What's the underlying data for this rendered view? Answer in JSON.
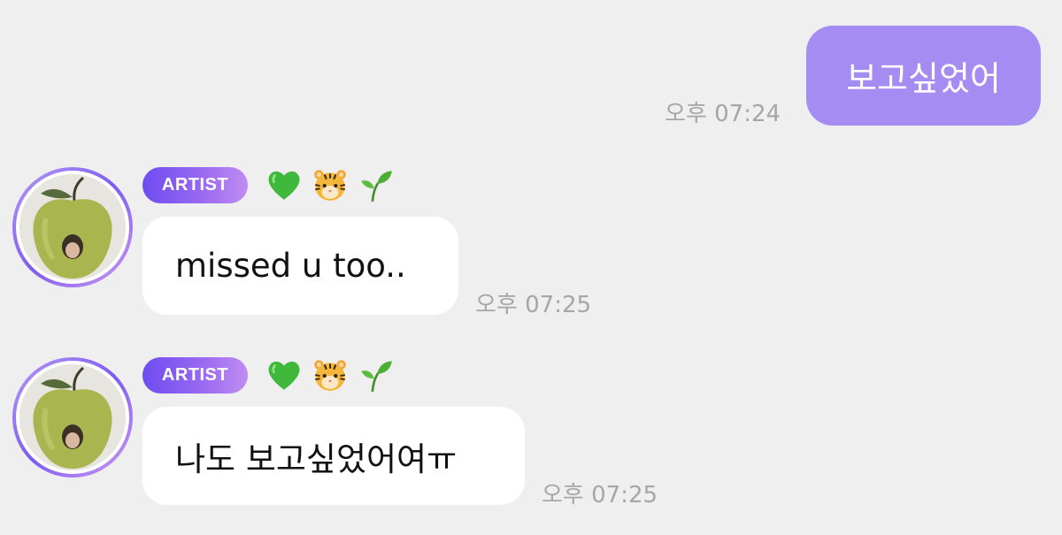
{
  "messages": [
    {
      "direction": "outgoing",
      "text": "보고싶었어",
      "time": "오후 07:24"
    },
    {
      "direction": "incoming",
      "sender_badge": "ARTIST",
      "emojis": [
        "green-heart",
        "tiger-face",
        "seedling"
      ],
      "text": "missed u too..",
      "time": "오후 07:25"
    },
    {
      "direction": "incoming",
      "sender_badge": "ARTIST",
      "emojis": [
        "green-heart",
        "tiger-face",
        "seedling"
      ],
      "text": "나도 보고싶었어여ㅠ",
      "time": "오후 07:25"
    }
  ],
  "colors": {
    "background": "#efefef",
    "outgoing_bubble": "#a58cf2",
    "incoming_bubble": "#ffffff",
    "badge_start": "#6e4cf0",
    "badge_end": "#c08cf2",
    "timestamp": "#a6a6a6"
  }
}
